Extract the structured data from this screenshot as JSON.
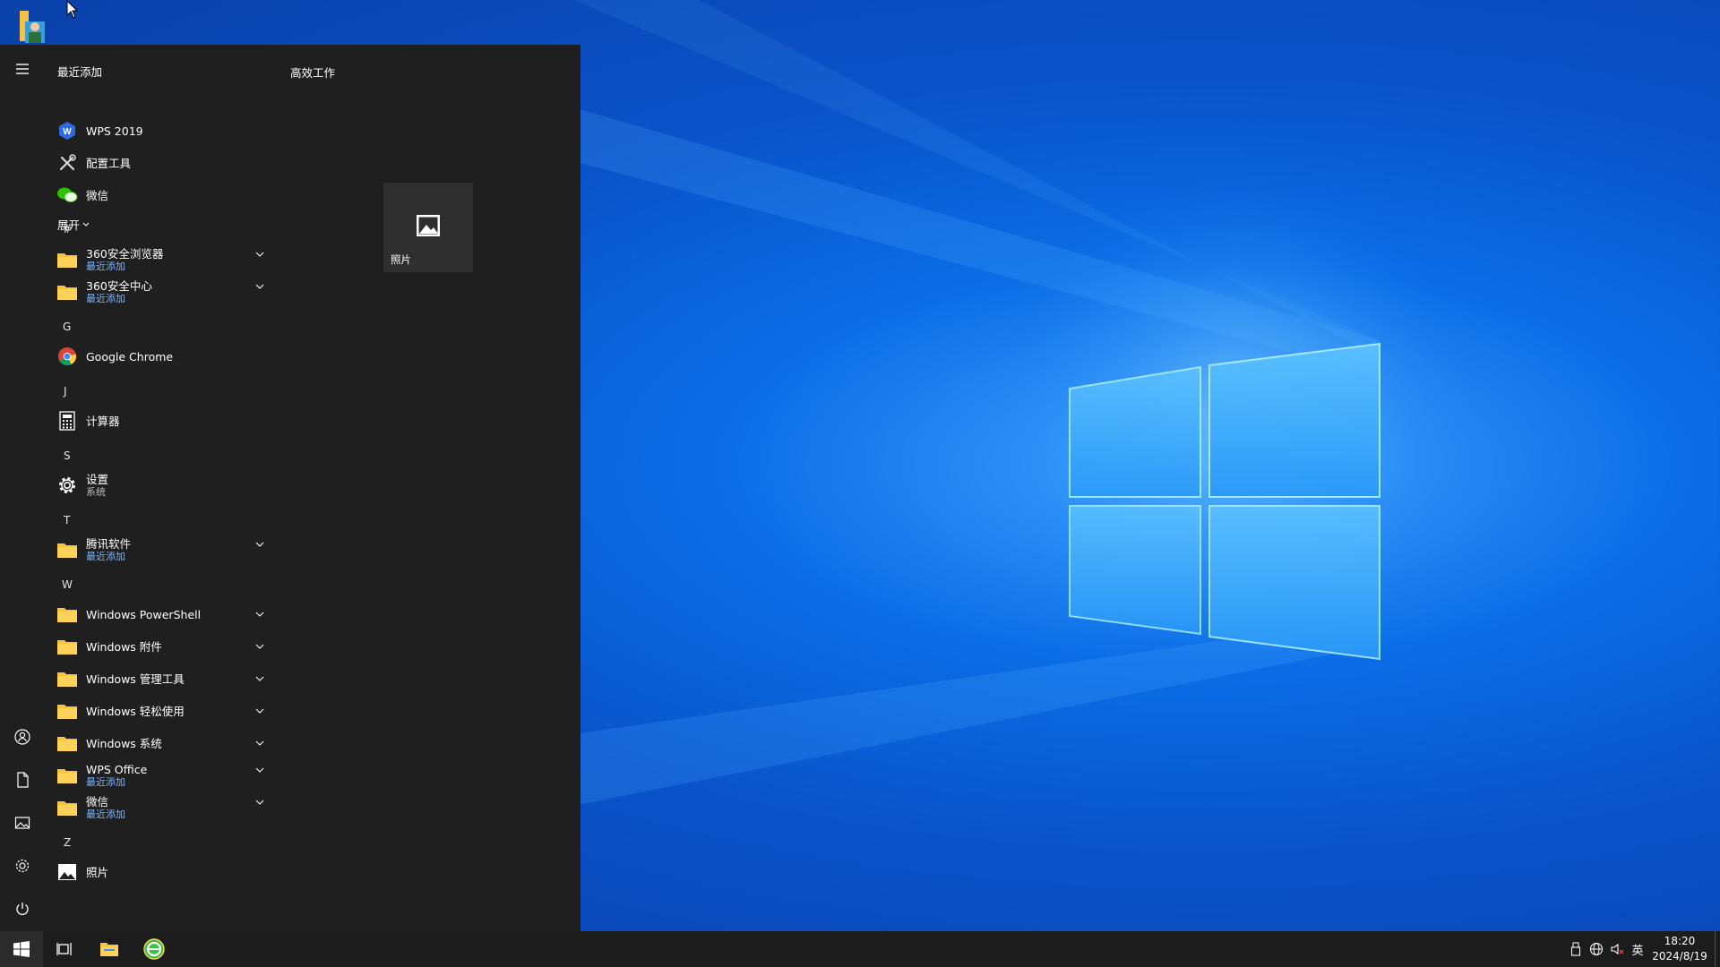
{
  "start_menu": {
    "recent_header": "最近添加",
    "recent_apps": [
      {
        "label": "WPS 2019",
        "icon": "wps-icon"
      },
      {
        "label": "配置工具",
        "icon": "tools-icon"
      },
      {
        "label": "微信",
        "icon": "wechat-icon"
      }
    ],
    "expand_label": "展开",
    "groups": {
      "hash": {
        "letter": "#",
        "items": [
          {
            "label": "360安全浏览器",
            "sub": "最近添加",
            "icon": "folder-icon"
          },
          {
            "label": "360安全中心",
            "sub": "最近添加",
            "icon": "folder-icon"
          }
        ]
      },
      "g": {
        "letter": "G",
        "items": [
          {
            "label": "Google Chrome",
            "icon": "chrome-icon"
          }
        ]
      },
      "j": {
        "letter": "J",
        "items": [
          {
            "label": "计算器",
            "icon": "calculator-icon"
          }
        ]
      },
      "s": {
        "letter": "S",
        "items": [
          {
            "label": "设置",
            "sub": "系统",
            "icon": "gear-icon"
          }
        ]
      },
      "t": {
        "letter": "T",
        "items": [
          {
            "label": "腾讯软件",
            "sub": "最近添加",
            "icon": "folder-icon"
          }
        ]
      },
      "w": {
        "letter": "W",
        "items": [
          {
            "label": "Windows PowerShell",
            "icon": "folder-icon"
          },
          {
            "label": "Windows 附件",
            "icon": "folder-icon"
          },
          {
            "label": "Windows 管理工具",
            "icon": "folder-icon"
          },
          {
            "label": "Windows 轻松使用",
            "icon": "folder-icon"
          },
          {
            "label": "Windows 系统",
            "icon": "folder-icon"
          },
          {
            "label": "WPS Office",
            "sub": "最近添加",
            "icon": "folder-icon"
          },
          {
            "label": "微信",
            "sub": "最近添加",
            "icon": "folder-icon"
          }
        ]
      },
      "z": {
        "letter": "Z",
        "items": [
          {
            "label": "照片",
            "icon": "photos-icon"
          }
        ]
      }
    },
    "tiles_header": "高效工作",
    "tiles": [
      {
        "label": "照片",
        "icon": "photos-icon"
      }
    ]
  },
  "taskbar": {
    "ime_label": "英",
    "time": "18:20",
    "date": "2024/8/19"
  },
  "colors": {
    "menu_bg": "#1f1f1f",
    "taskbar_bg": "#1c1c1c",
    "recent_sub": "#7fb5ff",
    "folder": "#f8c43e",
    "desktop_blue": "#0b6ee6"
  }
}
